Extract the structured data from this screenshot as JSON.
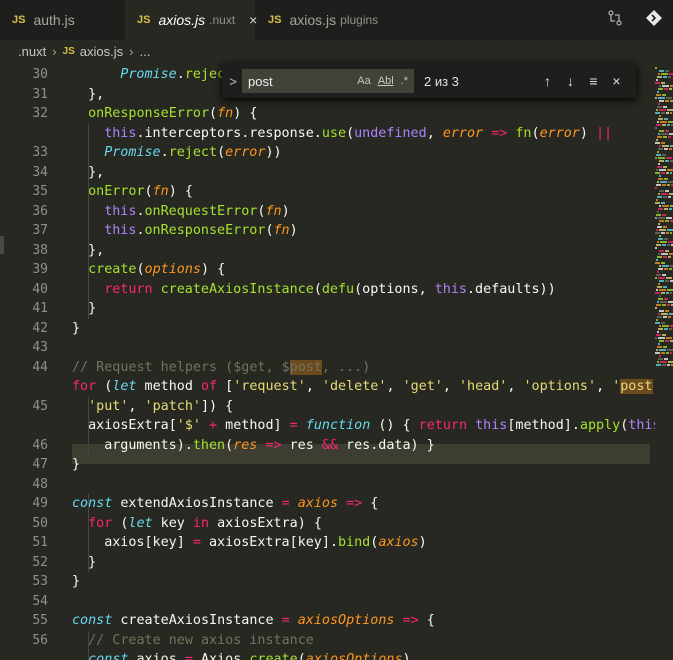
{
  "tabs": [
    {
      "icon": "JS",
      "label": "auth.js",
      "desc": "",
      "active": false
    },
    {
      "icon": "JS",
      "label": "axios.js",
      "desc": ".nuxt",
      "active": true,
      "close": "×"
    },
    {
      "icon": "JS",
      "label": "axios.js",
      "desc": "plugins",
      "active": false
    }
  ],
  "breadcrumb": {
    "folder": ".nuxt",
    "icon": "JS",
    "file": "axios.js",
    "more": "..."
  },
  "find": {
    "toggle": ">",
    "query": "post",
    "case": "Aa",
    "word": "Abl",
    "regex": ".*",
    "count": "2 из 3",
    "prev": "↑",
    "next": "↓",
    "selection": "≡",
    "close": "×"
  },
  "line_numbers": [
    "30",
    "31",
    "32",
    "",
    "33",
    "34",
    "35",
    "36",
    "37",
    "38",
    "39",
    "40",
    "41",
    "42",
    "43",
    "44",
    "",
    "45",
    "",
    "46",
    "47",
    "48",
    "49",
    "50",
    "51",
    "52",
    "53",
    "54",
    "55",
    "56"
  ],
  "code_lines": [
    "Promise.reject(",
    "},",
    "onResponseError(fn) {",
    "this.interceptors.response.use(undefined, error => fn(error) ||",
    "Promise.reject(error))",
    "},",
    "onError(fn) {",
    "this.onRequestError(fn)",
    "this.onResponseError(fn)",
    "},",
    "create(options) {",
    "return createAxiosInstance(defu(options, this.defaults))",
    "}",
    "}",
    "// Request helpers ($get, $post, ...)",
    "for (let method of ['request', 'delete', 'get', 'head', 'options', 'post',",
    "'put', 'patch']) {",
    "axiosExtra['$' + method] = function () { return this[method].apply(this,",
    "arguments).then(res => res && res.data) }",
    "}",
    "const extendAxiosInstance = axios => {",
    "for (let key in axiosExtra) {",
    "axios[key] = axiosExtra[key].bind(axios)",
    "}",
    "}",
    "const createAxiosInstance = axiosOptions => {",
    "// Create new axios instance",
    "const axios = Axios.create(axiosOptions)"
  ]
}
